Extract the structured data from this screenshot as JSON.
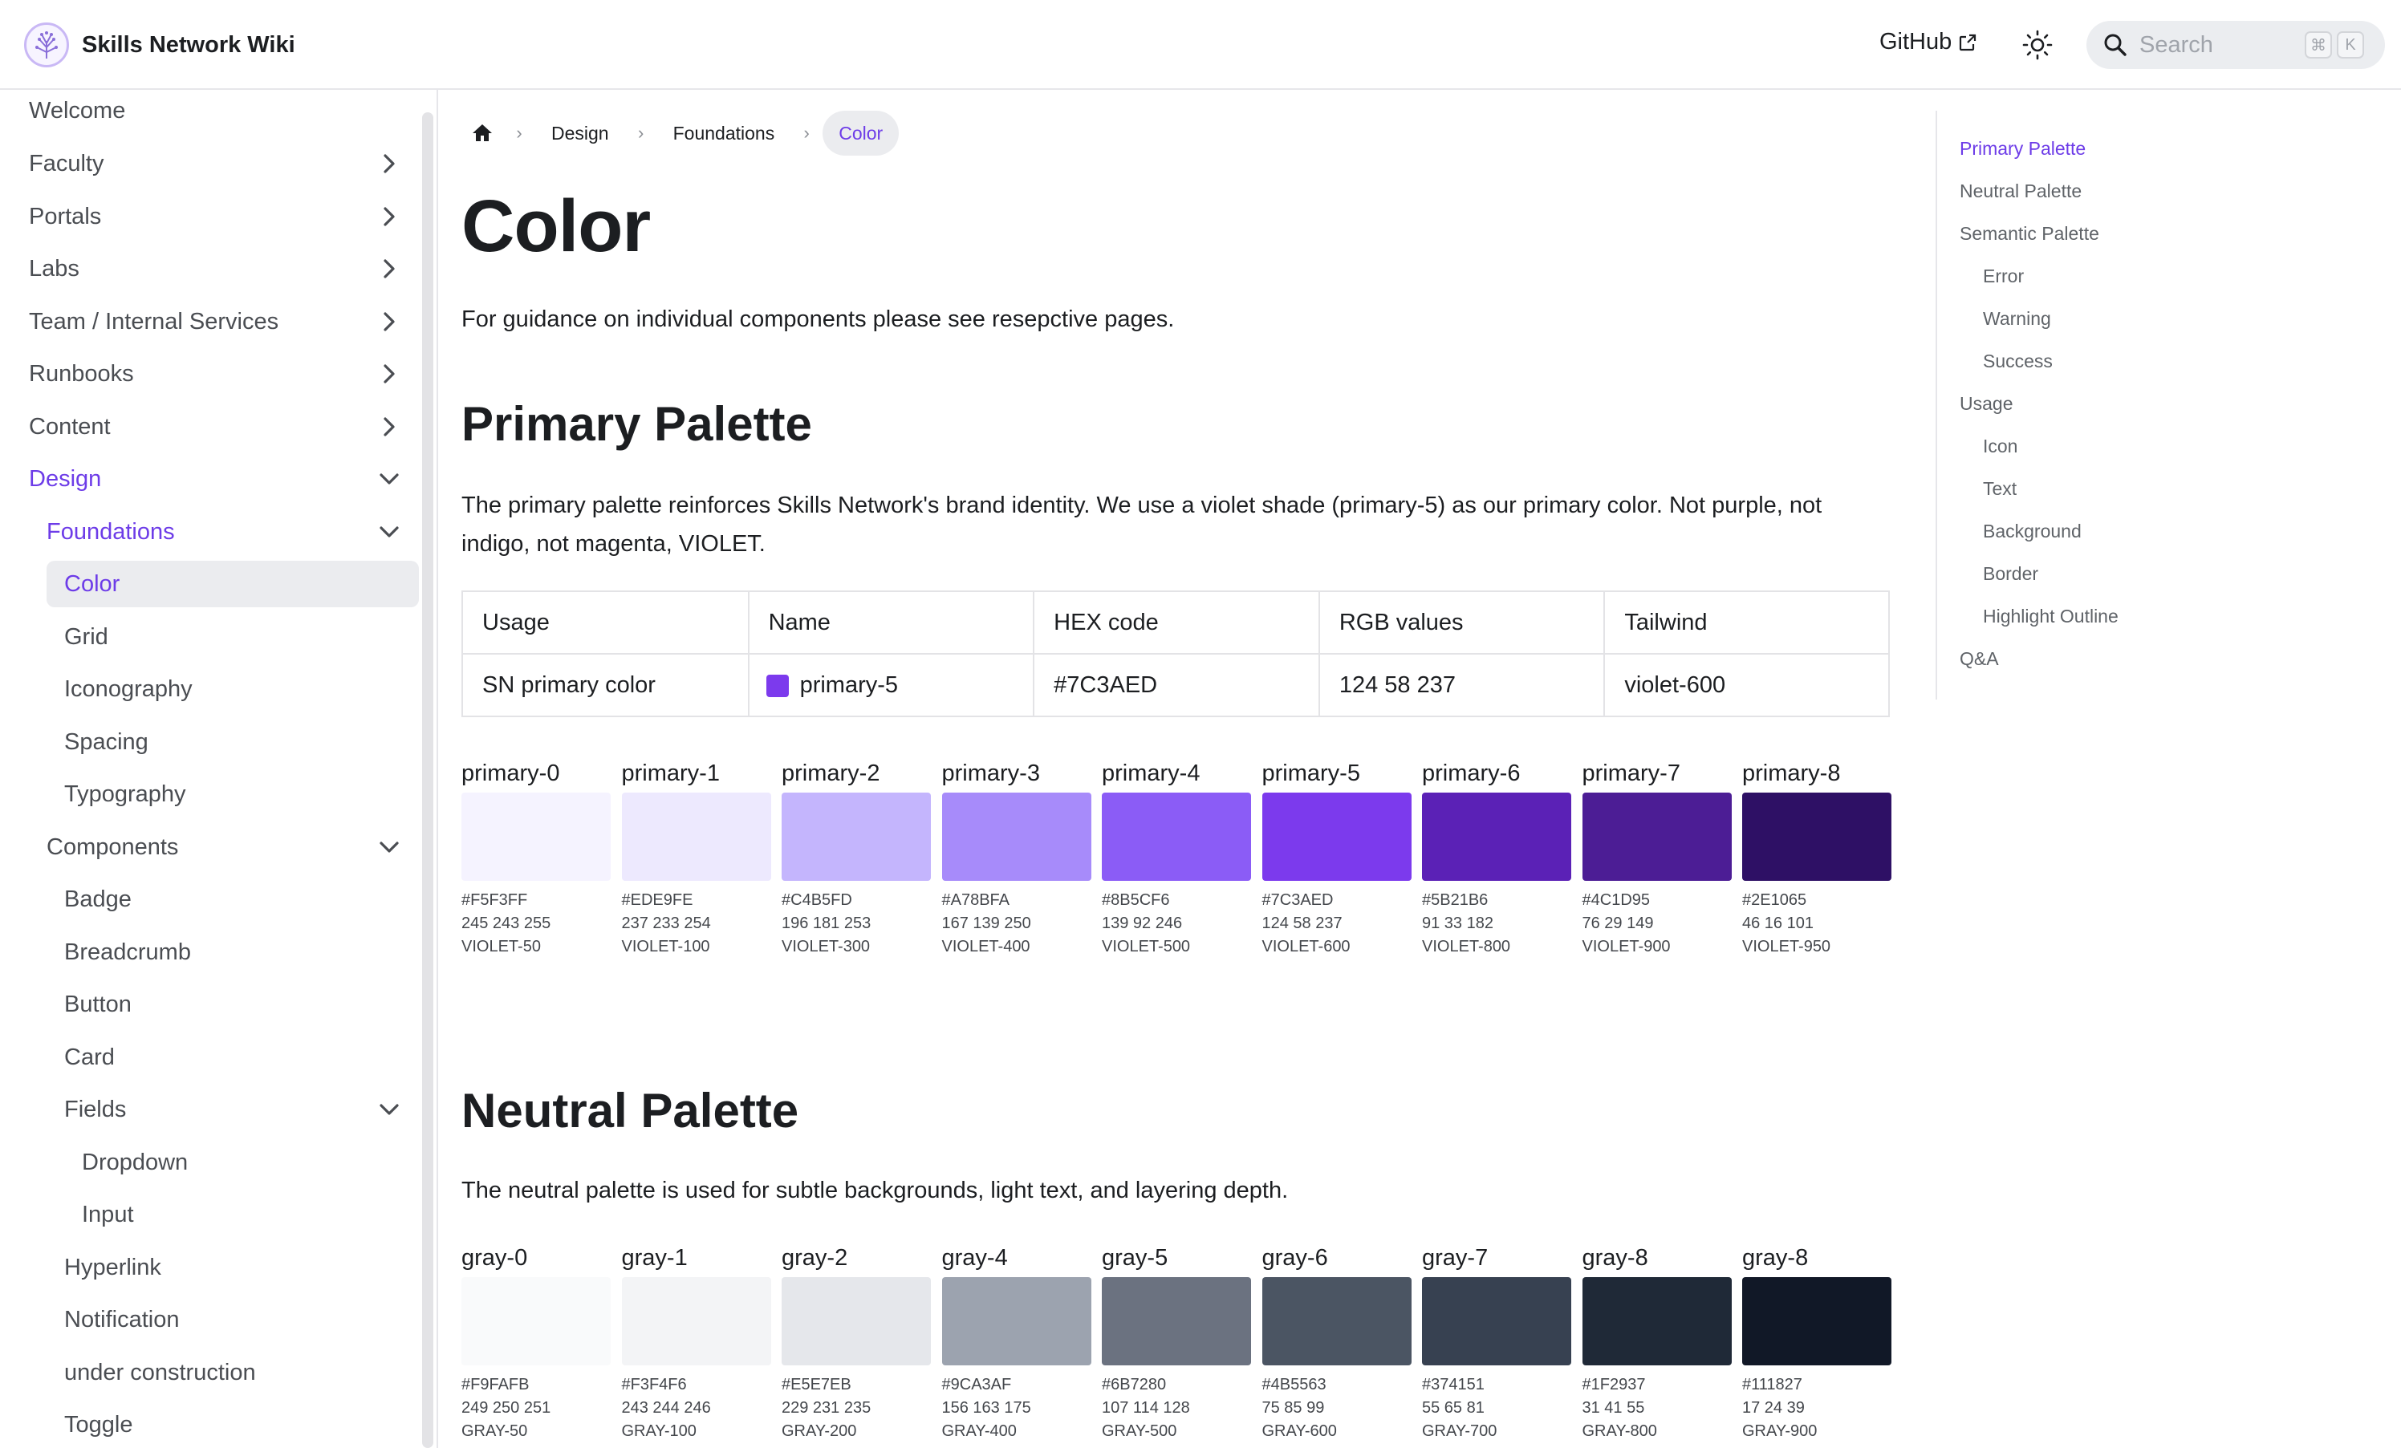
{
  "navbar": {
    "title": "Skills Network Wiki",
    "github_label": "GitHub",
    "search_placeholder": "Search",
    "search_kbd_1": "⌘",
    "search_kbd_2": "K"
  },
  "sidebar": {
    "items": [
      {
        "label": "Welcome"
      },
      {
        "label": "Faculty"
      },
      {
        "label": "Portals"
      },
      {
        "label": "Labs"
      },
      {
        "label": "Team / Internal Services"
      },
      {
        "label": "Runbooks"
      },
      {
        "label": "Content"
      },
      {
        "label": "Design"
      },
      {
        "label": "Foundations"
      },
      {
        "label": "Color"
      },
      {
        "label": "Grid"
      },
      {
        "label": "Iconography"
      },
      {
        "label": "Spacing"
      },
      {
        "label": "Typography"
      },
      {
        "label": "Components"
      },
      {
        "label": "Badge"
      },
      {
        "label": "Breadcrumb"
      },
      {
        "label": "Button"
      },
      {
        "label": "Card"
      },
      {
        "label": "Fields"
      },
      {
        "label": "Dropdown"
      },
      {
        "label": "Input"
      },
      {
        "label": "Hyperlink"
      },
      {
        "label": "Notification"
      },
      {
        "label": "under construction"
      },
      {
        "label": "Toggle"
      }
    ]
  },
  "breadcrumbs": [
    "Design",
    "Foundations",
    "Color"
  ],
  "page": {
    "title": "Color",
    "intro": "For guidance on individual components please see resepctive pages.",
    "primary": {
      "heading": "Primary Palette",
      "description": "The primary palette reinforces Skills Network's brand identity. We use a violet shade (primary-5) as our primary color. Not purple, not indigo, not magenta, VIOLET.",
      "table": {
        "headers": [
          "Usage",
          "Name",
          "HEX code",
          "RGB values",
          "Tailwind"
        ],
        "row": {
          "usage": "SN primary color",
          "name": "primary-5",
          "hex": "#7C3AED",
          "rgb": "124 58 237",
          "tailwind": "violet-600"
        }
      },
      "swatches": [
        {
          "name": "primary-0",
          "hex": "#F5F3FF",
          "rgb": "245 243 255",
          "tailwind": "VIOLET-50"
        },
        {
          "name": "primary-1",
          "hex": "#EDE9FE",
          "rgb": "237 233 254",
          "tailwind": "VIOLET-100"
        },
        {
          "name": "primary-2",
          "hex": "#C4B5FD",
          "rgb": "196 181 253",
          "tailwind": "VIOLET-300"
        },
        {
          "name": "primary-3",
          "hex": "#A78BFA",
          "rgb": "167 139 250",
          "tailwind": "VIOLET-400"
        },
        {
          "name": "primary-4",
          "hex": "#8B5CF6",
          "rgb": "139 92 246",
          "tailwind": "VIOLET-500"
        },
        {
          "name": "primary-5",
          "hex": "#7C3AED",
          "rgb": "124 58 237",
          "tailwind": "VIOLET-600"
        },
        {
          "name": "primary-6",
          "hex": "#5B21B6",
          "rgb": "91 33 182",
          "tailwind": "VIOLET-800"
        },
        {
          "name": "primary-7",
          "hex": "#4C1D95",
          "rgb": "76 29 149",
          "tailwind": "VIOLET-900"
        },
        {
          "name": "primary-8",
          "hex": "#2E1065",
          "rgb": "46 16 101",
          "tailwind": "VIOLET-950"
        }
      ]
    },
    "neutral": {
      "heading": "Neutral Palette",
      "description": "The neutral palette is used for subtle backgrounds, light text, and layering depth.",
      "swatches": [
        {
          "name": "gray-0",
          "hex": "#F9FAFB",
          "rgb": "249 250 251",
          "tailwind": "GRAY-50"
        },
        {
          "name": "gray-1",
          "hex": "#F3F4F6",
          "rgb": "243 244 246",
          "tailwind": "GRAY-100"
        },
        {
          "name": "gray-2",
          "hex": "#E5E7EB",
          "rgb": "229 231 235",
          "tailwind": "GRAY-200"
        },
        {
          "name": "gray-4",
          "hex": "#9CA3AF",
          "rgb": "156 163 175",
          "tailwind": "GRAY-400"
        },
        {
          "name": "gray-5",
          "hex": "#6B7280",
          "rgb": "107 114 128",
          "tailwind": "GRAY-500"
        },
        {
          "name": "gray-6",
          "hex": "#4B5563",
          "rgb": "75 85 99",
          "tailwind": "GRAY-600"
        },
        {
          "name": "gray-7",
          "hex": "#374151",
          "rgb": "55 65 81",
          "tailwind": "GRAY-700"
        },
        {
          "name": "gray-8",
          "hex": "#1F2937",
          "rgb": "31 41 55",
          "tailwind": "GRAY-800"
        },
        {
          "name": "gray-8",
          "hex": "#111827",
          "rgb": "17 24 39",
          "tailwind": "GRAY-900"
        }
      ]
    }
  },
  "toc": [
    {
      "label": "Primary Palette"
    },
    {
      "label": "Neutral Palette"
    },
    {
      "label": "Semantic Palette"
    },
    {
      "label": "Error"
    },
    {
      "label": "Warning"
    },
    {
      "label": "Success"
    },
    {
      "label": "Usage"
    },
    {
      "label": "Icon"
    },
    {
      "label": "Text"
    },
    {
      "label": "Background"
    },
    {
      "label": "Border"
    },
    {
      "label": "Highlight Outline"
    },
    {
      "label": "Q&A"
    }
  ],
  "colors": {
    "accent": "#6D3CE8",
    "current_bg": "#EBECEF"
  }
}
